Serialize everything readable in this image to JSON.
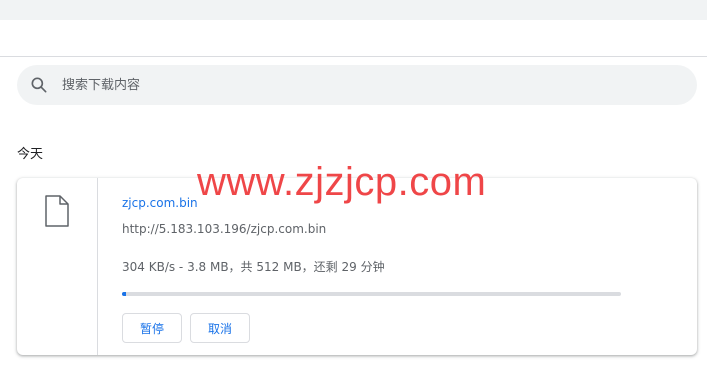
{
  "search": {
    "placeholder": "搜索下载内容",
    "value": ""
  },
  "section": {
    "title": "今天"
  },
  "download": {
    "file_name": "zjcp.com.bin",
    "url": "http://5.183.103.196/zjcp.com.bin",
    "status": "304 KB/s - 3.8 MB，共 512 MB，还剩 29 分钟",
    "progress_fraction": 0.0074,
    "pause_label": "暂停",
    "cancel_label": "取消"
  },
  "watermark": {
    "text": "www.zjzjcp.com"
  },
  "icons": {
    "search": "search-icon",
    "file": "file-icon"
  },
  "colors": {
    "accent": "#1a73e8",
    "watermark": "#ef4648",
    "search_bg": "#f1f3f4"
  }
}
